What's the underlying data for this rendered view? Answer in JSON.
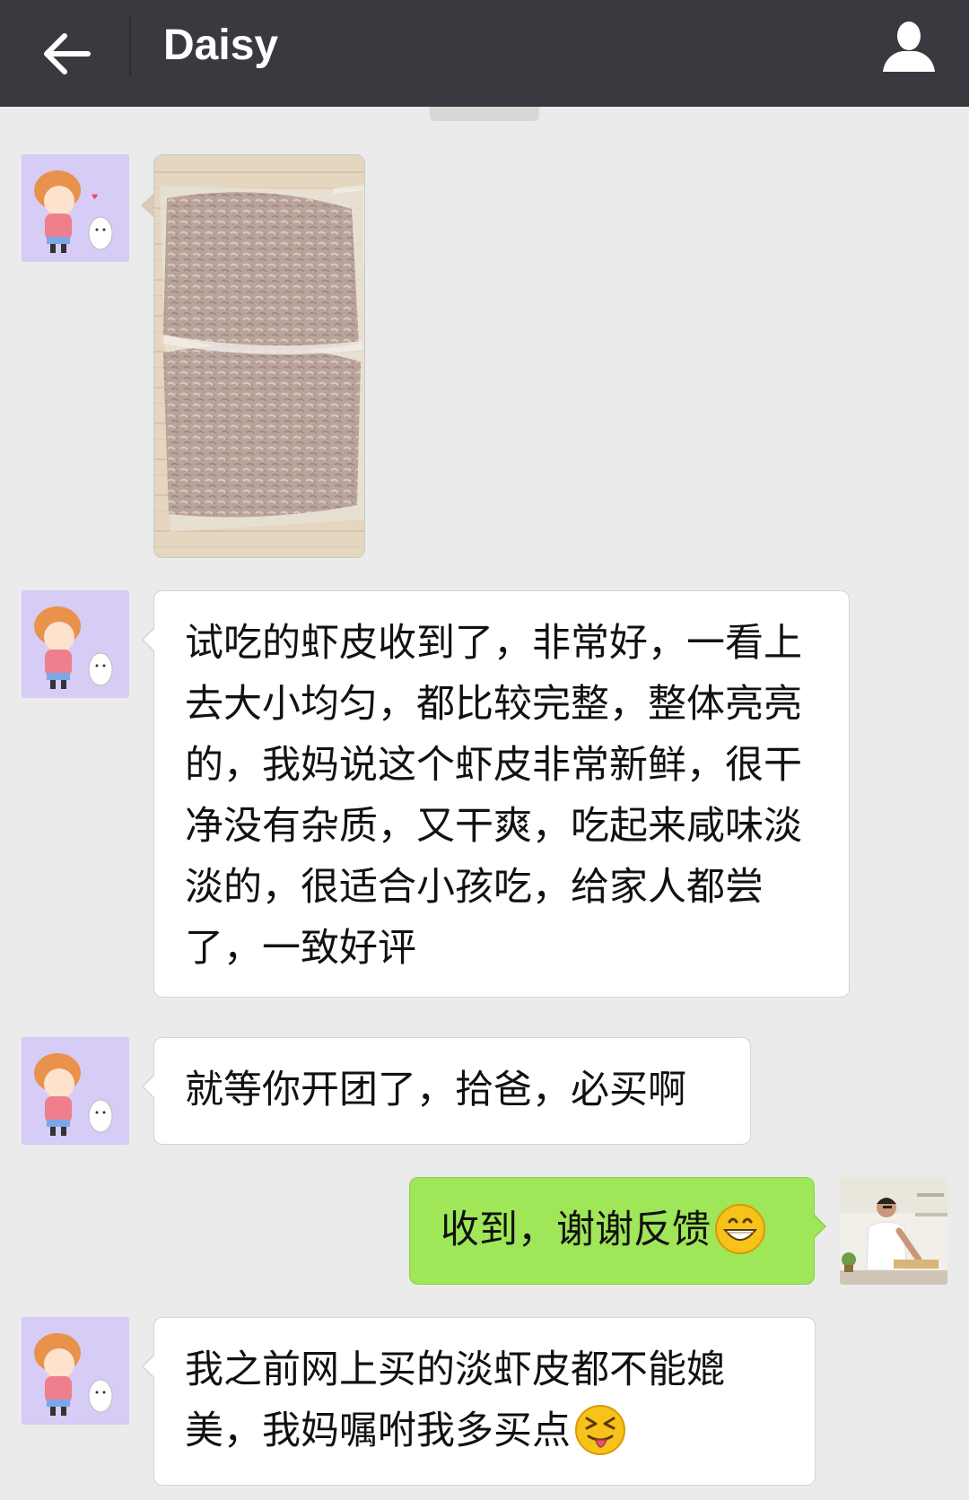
{
  "header": {
    "title": "Daisy",
    "back_icon": "arrow-left-icon",
    "profile_icon": "person-icon",
    "background": "#393a3f"
  },
  "colors": {
    "chat_background": "#ebebeb",
    "incoming_bubble": "#ffffff",
    "outgoing_bubble": "#9fe658"
  },
  "messages": [
    {
      "sender": "Daisy",
      "type": "image",
      "alt_icon": "shrimp-photo"
    },
    {
      "sender": "Daisy",
      "type": "text",
      "text": "试吃的虾皮收到了，非常好，一看上去大小均匀，都比较完整，整体亮亮的，我妈说这个虾皮非常新鲜，很干净没有杂质，又干爽，吃起来咸味淡淡的，很适合小孩吃，给家人都尝了，一致好评"
    },
    {
      "sender": "Daisy",
      "type": "text",
      "text": "就等你开团了，拾爸，必买啊"
    },
    {
      "sender": "me",
      "type": "text",
      "text": "收到，谢谢反馈",
      "emoji": "grinning-face-emoji"
    },
    {
      "sender": "Daisy",
      "type": "text",
      "text": "我之前网上买的淡虾皮都不能媲美，我妈嘱咐我多买点",
      "emoji": "squinting-tongue-emoji"
    }
  ]
}
